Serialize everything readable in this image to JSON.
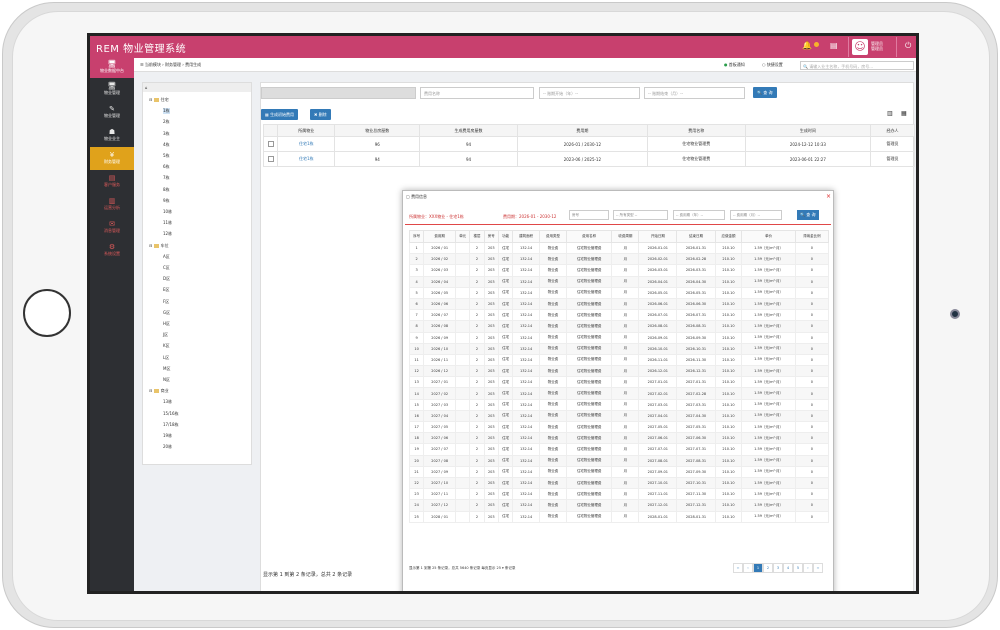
{
  "app": {
    "title": "REM 物业管理系统"
  },
  "topbar": {
    "user_line1": "管理员",
    "user_line2": "管理员",
    "avatar": "☺"
  },
  "sidebar": {
    "header": "物业数据中台",
    "items": [
      {
        "label": "物业管理",
        "icon": "🖥"
      },
      {
        "label": "物业管理",
        "icon": "✎"
      },
      {
        "label": "物业业主",
        "icon": "☗"
      },
      {
        "label": "财务管理",
        "icon": "¥"
      },
      {
        "label": "客户服务",
        "icon": "▤"
      },
      {
        "label": "运营分析",
        "icon": "▥"
      },
      {
        "label": "消息管理",
        "icon": "✉"
      },
      {
        "label": "系统设置",
        "icon": "⚙"
      }
    ]
  },
  "breadcrumb": {
    "current": "当前模块",
    "path": "财务管理 › 费用生成"
  },
  "top_options": {
    "radio1": "首板通知",
    "radio2": "快捷设置",
    "search_placeholder": "请输入业主名称，手机号码，房号..."
  },
  "tree": {
    "root": "⌂",
    "groups": [
      {
        "label": "住宅",
        "children": [
          "1栋",
          "2栋",
          "3栋",
          "4栋",
          "5栋",
          "6栋",
          "7栋",
          "8栋",
          "9栋",
          "10栋",
          "11栋",
          "12栋"
        ]
      },
      {
        "label": "车位",
        "children": [
          "A区",
          "C区",
          "D区",
          "E区",
          "F区",
          "G区",
          "H区",
          "J区",
          "K区",
          "L区",
          "M区",
          "N区"
        ]
      },
      {
        "label": "商业",
        "children": [
          "13栋",
          "15/16栋",
          "17/18栋",
          "19栋",
          "20栋"
        ]
      }
    ]
  },
  "filters": {
    "project_name": "",
    "fee_name": "费用名称",
    "period_start": "-- 账期开始（年）--",
    "period_end": "-- 账期结束（月）--",
    "search": "查 询"
  },
  "actions": {
    "generate": "生成初始费用",
    "delete": "删除"
  },
  "table": {
    "headers": [
      "",
      "所属物业",
      "物业总房屋数",
      "生成费用房屋数",
      "费用期",
      "费用名称",
      "生成时间",
      "经办人"
    ],
    "rows": [
      [
        "",
        "住宅1栋",
        "96",
        "94",
        "2026-01 / 2030-12",
        "住宅物业管理费",
        "2024-12-12 10:33",
        "管理员"
      ],
      [
        "",
        "住宅1栋",
        "94",
        "94",
        "2023-06 / 2025-12",
        "住宅物业管理费",
        "2023-06-01 22:27",
        "管理员"
      ]
    ],
    "pager": "显示第 1 到第 2 条记录，总共 2 条记录"
  },
  "modal": {
    "title": "费用信息",
    "info_left": "所属物业：XXX物业 - 住宅1栋",
    "info_mid": "费用期：2026-01 - 2030-12",
    "filter_room": "房号",
    "filter_type": "-- 所有类型 --",
    "filter_start": "-- 费用期（年）--",
    "filter_end": "-- 费用期（月）--",
    "search": "查 询",
    "headers": [
      "序号",
      "费用期",
      "单元",
      "楼层",
      "房号",
      "功能",
      "建筑面积",
      "费用类型",
      "费用名称",
      "收费周期",
      "开始日期",
      "结束日期",
      "应缴金额",
      "单价",
      "滞纳金比例"
    ],
    "rows": [
      [
        "1",
        "2026 / 01",
        "2",
        "203",
        "住宅",
        "132.14",
        "物业费",
        "住宅物业管理费",
        "月",
        "2026-01-01",
        "2026-01-31",
        "210.10",
        "1.59（元/m²·月）",
        "0"
      ],
      [
        "2",
        "2026 / 02",
        "2",
        "203",
        "住宅",
        "132.14",
        "物业费",
        "住宅物业管理费",
        "月",
        "2026-02-01",
        "2026-02-28",
        "210.10",
        "1.59（元/m²·月）",
        "0"
      ],
      [
        "3",
        "2026 / 03",
        "2",
        "203",
        "住宅",
        "132.14",
        "物业费",
        "住宅物业管理费",
        "月",
        "2026-03-01",
        "2026-03-31",
        "210.10",
        "1.59（元/m²·月）",
        "0"
      ],
      [
        "4",
        "2026 / 04",
        "2",
        "203",
        "住宅",
        "132.14",
        "物业费",
        "住宅物业管理费",
        "月",
        "2026-04-01",
        "2026-04-30",
        "210.10",
        "1.59（元/m²·月）",
        "0"
      ],
      [
        "5",
        "2026 / 05",
        "2",
        "203",
        "住宅",
        "132.14",
        "物业费",
        "住宅物业管理费",
        "月",
        "2026-05-01",
        "2026-05-31",
        "210.10",
        "1.59（元/m²·月）",
        "0"
      ],
      [
        "6",
        "2026 / 06",
        "2",
        "203",
        "住宅",
        "132.14",
        "物业费",
        "住宅物业管理费",
        "月",
        "2026-06-01",
        "2026-06-30",
        "210.10",
        "1.59（元/m²·月）",
        "0"
      ],
      [
        "7",
        "2026 / 07",
        "2",
        "203",
        "住宅",
        "132.14",
        "物业费",
        "住宅物业管理费",
        "月",
        "2026-07-01",
        "2026-07-31",
        "210.10",
        "1.59（元/m²·月）",
        "0"
      ],
      [
        "8",
        "2026 / 08",
        "2",
        "203",
        "住宅",
        "132.14",
        "物业费",
        "住宅物业管理费",
        "月",
        "2026-08-01",
        "2026-08-31",
        "210.10",
        "1.59（元/m²·月）",
        "0"
      ],
      [
        "9",
        "2026 / 09",
        "2",
        "203",
        "住宅",
        "132.14",
        "物业费",
        "住宅物业管理费",
        "月",
        "2026-09-01",
        "2026-09-30",
        "210.10",
        "1.59（元/m²·月）",
        "0"
      ],
      [
        "10",
        "2026 / 10",
        "2",
        "203",
        "住宅",
        "132.14",
        "物业费",
        "住宅物业管理费",
        "月",
        "2026-10-01",
        "2026-10-31",
        "210.10",
        "1.59（元/m²·月）",
        "0"
      ],
      [
        "11",
        "2026 / 11",
        "2",
        "203",
        "住宅",
        "132.14",
        "物业费",
        "住宅物业管理费",
        "月",
        "2026-11-01",
        "2026-11-30",
        "210.10",
        "1.59（元/m²·月）",
        "0"
      ],
      [
        "12",
        "2026 / 12",
        "2",
        "203",
        "住宅",
        "132.14",
        "物业费",
        "住宅物业管理费",
        "月",
        "2026-12-01",
        "2026-12-31",
        "210.10",
        "1.59（元/m²·月）",
        "0"
      ],
      [
        "13",
        "2027 / 01",
        "2",
        "203",
        "住宅",
        "132.14",
        "物业费",
        "住宅物业管理费",
        "月",
        "2027-01-01",
        "2027-01-31",
        "210.10",
        "1.59（元/m²·月）",
        "0"
      ],
      [
        "14",
        "2027 / 02",
        "2",
        "203",
        "住宅",
        "132.14",
        "物业费",
        "住宅物业管理费",
        "月",
        "2027-02-01",
        "2027-02-28",
        "210.10",
        "1.59（元/m²·月）",
        "0"
      ],
      [
        "15",
        "2027 / 03",
        "2",
        "203",
        "住宅",
        "132.14",
        "物业费",
        "住宅物业管理费",
        "月",
        "2027-03-01",
        "2027-03-31",
        "210.10",
        "1.59（元/m²·月）",
        "0"
      ],
      [
        "16",
        "2027 / 04",
        "2",
        "203",
        "住宅",
        "132.14",
        "物业费",
        "住宅物业管理费",
        "月",
        "2027-04-01",
        "2027-04-30",
        "210.10",
        "1.59（元/m²·月）",
        "0"
      ],
      [
        "17",
        "2027 / 05",
        "2",
        "203",
        "住宅",
        "132.14",
        "物业费",
        "住宅物业管理费",
        "月",
        "2027-05-01",
        "2027-05-31",
        "210.10",
        "1.59（元/m²·月）",
        "0"
      ],
      [
        "18",
        "2027 / 06",
        "2",
        "203",
        "住宅",
        "132.14",
        "物业费",
        "住宅物业管理费",
        "月",
        "2027-06-01",
        "2027-06-30",
        "210.10",
        "1.59（元/m²·月）",
        "0"
      ],
      [
        "19",
        "2027 / 07",
        "2",
        "203",
        "住宅",
        "132.14",
        "物业费",
        "住宅物业管理费",
        "月",
        "2027-07-01",
        "2027-07-31",
        "210.10",
        "1.59（元/m²·月）",
        "0"
      ],
      [
        "20",
        "2027 / 08",
        "2",
        "203",
        "住宅",
        "132.14",
        "物业费",
        "住宅物业管理费",
        "月",
        "2027-08-01",
        "2027-08-31",
        "210.10",
        "1.59（元/m²·月）",
        "0"
      ],
      [
        "21",
        "2027 / 09",
        "2",
        "203",
        "住宅",
        "132.14",
        "物业费",
        "住宅物业管理费",
        "月",
        "2027-09-01",
        "2027-09-30",
        "210.10",
        "1.59（元/m²·月）",
        "0"
      ],
      [
        "22",
        "2027 / 10",
        "2",
        "203",
        "住宅",
        "132.14",
        "物业费",
        "住宅物业管理费",
        "月",
        "2027-10-01",
        "2027-10-31",
        "210.10",
        "1.59（元/m²·月）",
        "0"
      ],
      [
        "23",
        "2027 / 11",
        "2",
        "203",
        "住宅",
        "132.14",
        "物业费",
        "住宅物业管理费",
        "月",
        "2027-11-01",
        "2027-11-30",
        "210.10",
        "1.59（元/m²·月）",
        "0"
      ],
      [
        "24",
        "2027 / 12",
        "2",
        "203",
        "住宅",
        "132.14",
        "物业费",
        "住宅物业管理费",
        "月",
        "2027-12-01",
        "2027-12-31",
        "210.10",
        "1.59（元/m²·月）",
        "0"
      ],
      [
        "25",
        "2028 / 01",
        "2",
        "203",
        "住宅",
        "132.14",
        "物业费",
        "住宅物业管理费",
        "月",
        "2028-01-01",
        "2028-01-31",
        "210.10",
        "1.59（元/m²·月）",
        "0"
      ]
    ],
    "footer": "显示第 1 到第 25 条记录，总共 5640 条记录 每页显示 25 ▾ 条记录",
    "pages": [
      "‹‹",
      "‹",
      "1",
      "2",
      "3",
      "4",
      "5",
      "›",
      "››"
    ],
    "active_page": "1"
  }
}
